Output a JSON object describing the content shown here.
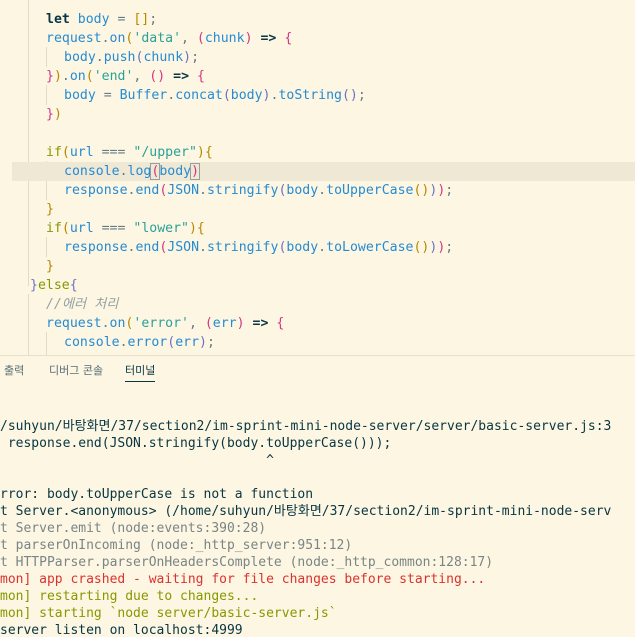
{
  "editor": {
    "lines": [
      {
        "tokens": [
          [
            "kw",
            "let "
          ],
          [
            "var",
            "body"
          ],
          [
            "op",
            " = "
          ],
          [
            "br1",
            "[]"
          ],
          [
            "pun",
            ";"
          ]
        ]
      },
      {
        "tokens": [
          [
            "var",
            "request"
          ],
          [
            "pun",
            "."
          ],
          [
            "fn",
            "on"
          ],
          [
            "br1",
            "("
          ],
          [
            "str",
            "'data'"
          ],
          [
            "pun",
            ", "
          ],
          [
            "br2",
            "("
          ],
          [
            "var",
            "chunk"
          ],
          [
            "br2",
            ")"
          ],
          [
            "op",
            " "
          ],
          [
            "kw",
            "=>"
          ],
          [
            "op",
            " "
          ],
          [
            "br2",
            "{"
          ]
        ]
      },
      {
        "tokens": [
          [
            "var",
            "body"
          ],
          [
            "pun",
            "."
          ],
          [
            "fn",
            "push"
          ],
          [
            "br3",
            "("
          ],
          [
            "var",
            "chunk"
          ],
          [
            "br3",
            ")"
          ],
          [
            "pun",
            ";"
          ]
        ]
      },
      {
        "tokens": [
          [
            "br2",
            "}"
          ],
          [
            "br1",
            ")"
          ],
          [
            "pun",
            "."
          ],
          [
            "fn",
            "on"
          ],
          [
            "br1",
            "("
          ],
          [
            "str",
            "'end'"
          ],
          [
            "pun",
            ", "
          ],
          [
            "br2",
            "()"
          ],
          [
            "op",
            " "
          ],
          [
            "kw",
            "=>"
          ],
          [
            "op",
            " "
          ],
          [
            "br2",
            "{"
          ]
        ]
      },
      {
        "tokens": [
          [
            "var",
            "body"
          ],
          [
            "op",
            " = "
          ],
          [
            "cls",
            "Buffer"
          ],
          [
            "pun",
            "."
          ],
          [
            "fn",
            "concat"
          ],
          [
            "br3",
            "("
          ],
          [
            "var",
            "body"
          ],
          [
            "br3",
            ")"
          ],
          [
            "pun",
            "."
          ],
          [
            "fn",
            "toString"
          ],
          [
            "br3",
            "()"
          ],
          [
            "pun",
            ";"
          ]
        ]
      },
      {
        "tokens": [
          [
            "br2",
            "}"
          ],
          [
            "br1",
            ")"
          ]
        ]
      },
      {
        "tokens": []
      },
      {
        "tokens": [
          [
            "ctl",
            "if"
          ],
          [
            "br1",
            "("
          ],
          [
            "var",
            "url"
          ],
          [
            "op",
            " === "
          ],
          [
            "str",
            "\"/upper\""
          ],
          [
            "br1",
            ")"
          ],
          [
            "br1",
            "{"
          ]
        ]
      },
      {
        "tokens": [
          [
            "var",
            "console"
          ],
          [
            "pun",
            "."
          ],
          [
            "fn",
            "log"
          ],
          [
            "br2",
            "("
          ],
          [
            "var",
            "body"
          ],
          [
            "br2",
            ")"
          ]
        ]
      },
      {
        "tokens": [
          [
            "var",
            "response"
          ],
          [
            "pun",
            "."
          ],
          [
            "fn",
            "end"
          ],
          [
            "br2",
            "("
          ],
          [
            "cls",
            "JSON"
          ],
          [
            "pun",
            "."
          ],
          [
            "fn",
            "stringify"
          ],
          [
            "br3",
            "("
          ],
          [
            "var",
            "body"
          ],
          [
            "pun",
            "."
          ],
          [
            "fn",
            "toUpperCase"
          ],
          [
            "br1",
            "()"
          ],
          [
            "br3",
            ")"
          ],
          [
            "br2",
            ")"
          ],
          [
            "pun",
            ";"
          ]
        ]
      },
      {
        "tokens": [
          [
            "br1",
            "}"
          ]
        ]
      },
      {
        "tokens": [
          [
            "ctl",
            "if"
          ],
          [
            "br1",
            "("
          ],
          [
            "var",
            "url"
          ],
          [
            "op",
            " === "
          ],
          [
            "str",
            "\"lower\""
          ],
          [
            "br1",
            ")"
          ],
          [
            "br1",
            "{"
          ]
        ]
      },
      {
        "tokens": [
          [
            "var",
            "response"
          ],
          [
            "pun",
            "."
          ],
          [
            "fn",
            "end"
          ],
          [
            "br2",
            "("
          ],
          [
            "cls",
            "JSON"
          ],
          [
            "pun",
            "."
          ],
          [
            "fn",
            "stringify"
          ],
          [
            "br3",
            "("
          ],
          [
            "var",
            "body"
          ],
          [
            "pun",
            "."
          ],
          [
            "fn",
            "toLowerCase"
          ],
          [
            "br1",
            "()"
          ],
          [
            "br3",
            ")"
          ],
          [
            "br2",
            ")"
          ],
          [
            "pun",
            ";"
          ]
        ]
      },
      {
        "tokens": [
          [
            "br1",
            "}"
          ]
        ]
      },
      {
        "tokens": [
          [
            "br3",
            "}"
          ],
          [
            "ctl",
            "else"
          ],
          [
            "br3",
            "{"
          ]
        ]
      },
      {
        "tokens": [
          [
            "cmt",
            "//에러 처리"
          ]
        ]
      },
      {
        "tokens": [
          [
            "var",
            "request"
          ],
          [
            "pun",
            "."
          ],
          [
            "fn",
            "on"
          ],
          [
            "br1",
            "("
          ],
          [
            "str",
            "'error'"
          ],
          [
            "pun",
            ", "
          ],
          [
            "br2",
            "("
          ],
          [
            "var",
            "err"
          ],
          [
            "br2",
            ")"
          ],
          [
            "op",
            " "
          ],
          [
            "kw",
            "=>"
          ],
          [
            "op",
            " "
          ],
          [
            "br2",
            "{"
          ]
        ]
      },
      {
        "tokens": [
          [
            "var",
            "console"
          ],
          [
            "pun",
            "."
          ],
          [
            "fn",
            "error"
          ],
          [
            "br3",
            "("
          ],
          [
            "var",
            "err"
          ],
          [
            "br3",
            ")"
          ],
          [
            "pun",
            ";"
          ]
        ]
      }
    ]
  },
  "panel": {
    "tabs": [
      {
        "label": "출력",
        "active": false
      },
      {
        "label": "디버그 콘솔",
        "active": false
      },
      {
        "label": "터미널",
        "active": true
      }
    ]
  },
  "terminal": {
    "lines": [
      {
        "text": "/suhyun/바탕화면/37/section2/im-sprint-mini-node-server/server/basic-server.js:3",
        "style": "normal"
      },
      {
        "text": " response.end(JSON.stringify(body.toUpperCase()));",
        "style": "normal"
      },
      {
        "text": "                                  ^",
        "style": "normal"
      },
      {
        "text": "",
        "style": "normal"
      },
      {
        "text": "rror: body.toUpperCase is not a function",
        "style": "normal"
      },
      {
        "text": "t Server.<anonymous> (/home/suhyun/바탕화면/37/section2/im-sprint-mini-node-serv",
        "style": "normal"
      },
      {
        "text": "t Server.emit (node:events:390:28)",
        "style": "gray"
      },
      {
        "text": "t parserOnIncoming (node:_http_server:951:12)",
        "style": "gray"
      },
      {
        "text": "t HTTPParser.parserOnHeadersComplete (node:_http_common:128:17)",
        "style": "gray"
      },
      {
        "text": "mon] app crashed - waiting for file changes before starting...",
        "style": "red"
      },
      {
        "text": "mon] restarting due to changes...",
        "style": "green"
      },
      {
        "text": "mon] starting `node server/basic-server.js`",
        "style": "green"
      },
      {
        "text": "server listen on localhost:4999",
        "style": "normal"
      }
    ]
  }
}
